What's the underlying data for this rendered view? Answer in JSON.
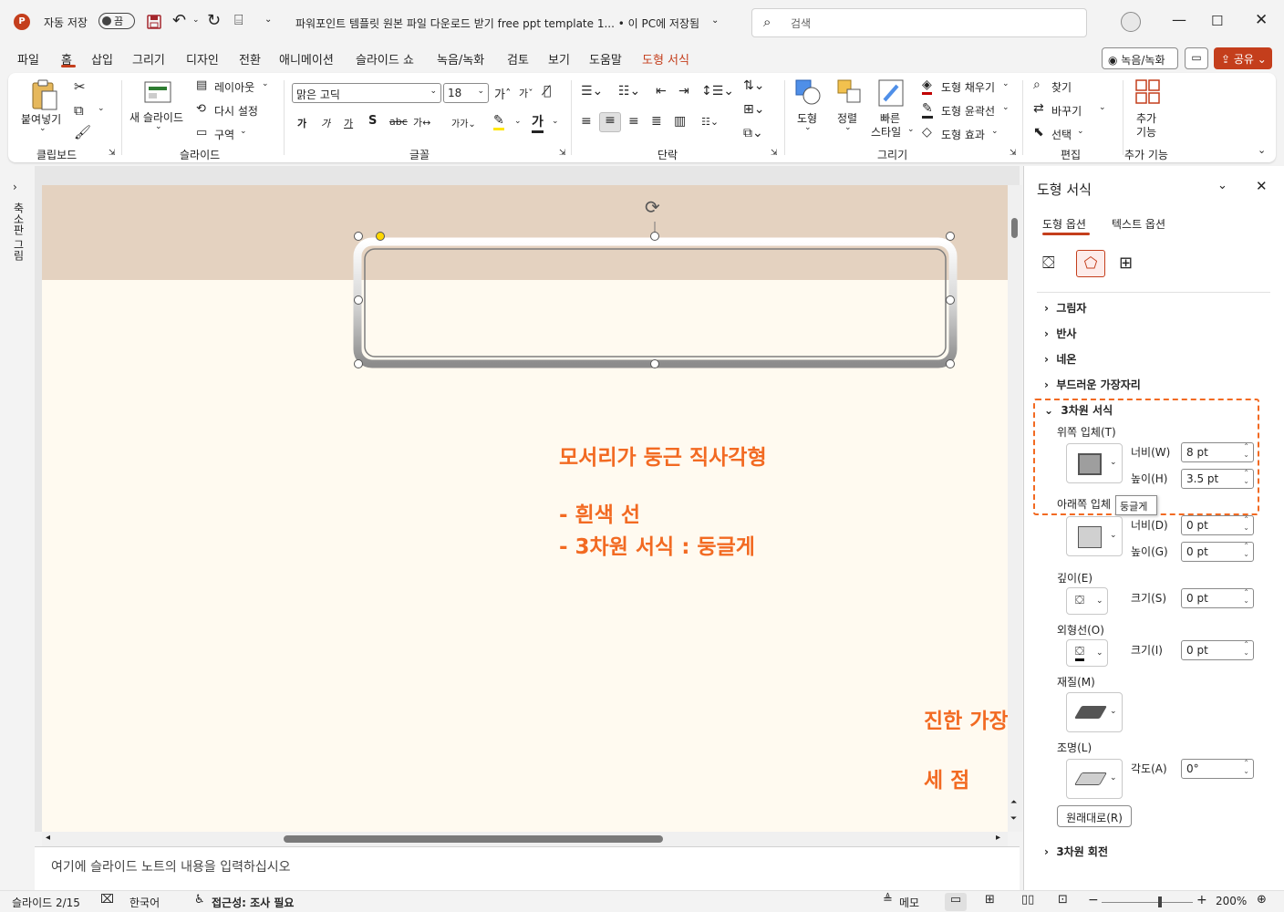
{
  "titlebar": {
    "autosave_label": "자동 저장",
    "autosave_state": "끔",
    "doc_title": "파워포인트 템플릿 원본 파일 다운로드 받기 free ppt template 1... • 이 PC에 저장됨",
    "search_placeholder": "검색"
  },
  "menu": {
    "items": [
      "파일",
      "홈",
      "삽입",
      "그리기",
      "디자인",
      "전환",
      "애니메이션",
      "슬라이드 쇼",
      "녹음/녹화",
      "검토",
      "보기",
      "도움말",
      "도형 서식"
    ],
    "record_button": "녹음/녹화",
    "share_button": "공유"
  },
  "ribbon": {
    "paste": "붙여넣기",
    "new_slide": "새 슬라이드",
    "layout": "레이아웃",
    "reset": "다시 설정",
    "section": "구역",
    "font_name": "맑은 고딕",
    "font_size": "18",
    "shape": "도형",
    "arrange": "정렬",
    "quick_style_1": "빠른",
    "quick_style_2": "스타일",
    "shape_fill": "도형 채우기",
    "shape_outline": "도형 윤곽선",
    "shape_effects": "도형 효과",
    "find": "찾기",
    "replace": "바꾸기",
    "select": "선택",
    "addins_1": "추가",
    "addins_2": "기능",
    "groups": {
      "clipboard": "클립보드",
      "slides": "슬라이드",
      "font": "글꼴",
      "paragraph": "단락",
      "drawing": "그리기",
      "editing": "편집",
      "addins": "추가 기능"
    }
  },
  "leftpane": {
    "label": "축소판 그림"
  },
  "slide": {
    "annotation_title": "모서리가 둥근 직사각형",
    "annotation_line1": "- 흰색 선",
    "annotation_line2": "- 3차원 서식 : 둥글게",
    "annotation_edge": "진한 가장자리",
    "annotation_dots": "세 점"
  },
  "notes": {
    "placeholder": "여기에 슬라이드 노트의 내용을 입력하십시오"
  },
  "panel": {
    "title": "도형 서식",
    "tab_shape": "도형 옵션",
    "tab_text": "텍스트 옵션",
    "sections": {
      "shadow": "그림자",
      "reflection": "반사",
      "glow": "네온",
      "soft_edges": "부드러운 가장자리",
      "format_3d": "3차원 서식",
      "rotation_3d": "3차원 회전"
    },
    "top_bevel": "위쪽 입체(T)",
    "bottom_bevel": "아래쪽 입체",
    "width_label": "너비(W)",
    "height_label": "높이(H)",
    "width_label_d": "너비(D)",
    "height_label_g": "높이(G)",
    "top_width": "8 pt",
    "top_height": "3.5 pt",
    "bottom_width": "0 pt",
    "bottom_height": "0 pt",
    "depth": "깊이(E)",
    "depth_size_label": "크기(S)",
    "depth_size": "0 pt",
    "contour": "외형선(O)",
    "contour_size_label": "크기(I)",
    "contour_size": "0 pt",
    "material": "재질(M)",
    "lighting": "조명(L)",
    "angle_label": "각도(A)",
    "angle": "0°",
    "reset": "원래대로(R)",
    "tooltip": "둥글게"
  },
  "status": {
    "slide_num": "슬라이드 2/15",
    "language": "한국어",
    "accessibility": "접근성: 조사 필요",
    "notes": "메모",
    "zoom": "200%"
  },
  "colors": {
    "accent": "#c43e1c",
    "annotation": "#f26a22",
    "slide_bg": "#fffaf0",
    "slide_band": "#e4d2c0"
  }
}
